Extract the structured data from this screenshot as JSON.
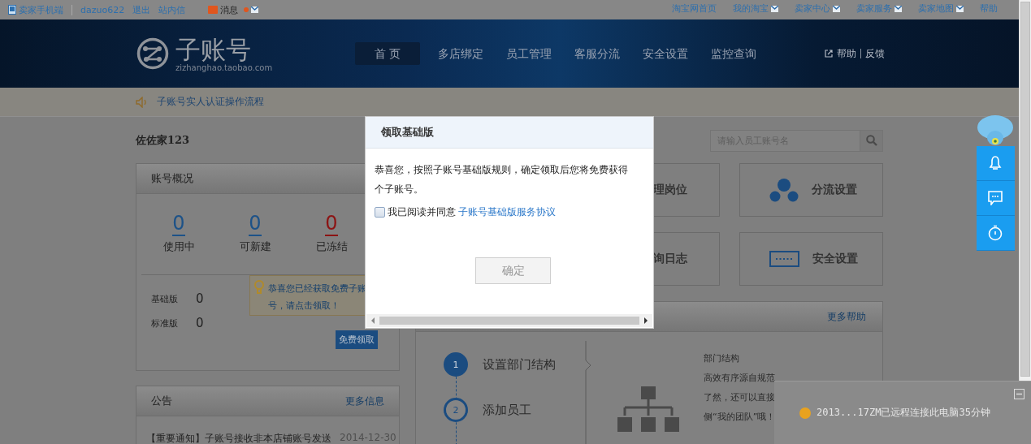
{
  "top_bar": {
    "left_links": [
      {
        "label": "卖家手机端",
        "kind": "phone"
      },
      {
        "label": "dazuo622",
        "kind": "plain"
      },
      {
        "label": "退出",
        "kind": "plain"
      },
      {
        "label": "站内信",
        "kind": "plain"
      }
    ],
    "message": {
      "label": "消息",
      "unread": true
    },
    "right_links": [
      {
        "label": "淘宝网首页",
        "dropdown": false
      },
      {
        "label": "我的淘宝",
        "dropdown": true
      },
      {
        "label": "卖家中心",
        "dropdown": true
      },
      {
        "label": "卖家服务",
        "dropdown": true
      },
      {
        "label": "卖家地图",
        "dropdown": true
      },
      {
        "label": "帮助",
        "dropdown": false
      }
    ]
  },
  "header": {
    "logo": {
      "title": "子账号",
      "subtitle": "zizhanghao.taobao.com"
    },
    "nav": [
      {
        "label": "首 页",
        "selected": true
      },
      {
        "label": "多店绑定",
        "selected": false
      },
      {
        "label": "员工管理",
        "selected": false
      },
      {
        "label": "客服分流",
        "selected": false
      },
      {
        "label": "安全设置",
        "selected": false
      },
      {
        "label": "监控查询",
        "selected": false
      }
    ],
    "help_links": [
      "帮助",
      "反馈"
    ]
  },
  "notice": {
    "text": "子账号实人认证操作流程"
  },
  "shop_name": "佐佐家123",
  "search": {
    "placeholder": "请输入员工账号名"
  },
  "account_panel": {
    "title": "账号概况",
    "stats": [
      {
        "value": "0",
        "label": "使用中",
        "color": "#1d5288"
      },
      {
        "value": "0",
        "label": "可新建",
        "color": "#1d5288"
      },
      {
        "value": "0",
        "label": "已冻结",
        "color": "#8c1414"
      }
    ],
    "versions": [
      {
        "label": "基础版",
        "count": "0"
      },
      {
        "label": "标准版",
        "count": "0"
      }
    ],
    "tip_lines": [
      "恭喜您已经获取免费子账",
      "号，请点击领取！"
    ],
    "button": "免费领取"
  },
  "announcements": {
    "title": "公告",
    "more": "更多信息",
    "items": [
      {
        "title": "【重要通知】子账号接收非本店铺账号发送",
        "date": "2014-12-30"
      }
    ]
  },
  "function_cards": [
    {
      "label": "理岗位",
      "kind": "covered"
    },
    {
      "label": "分流设置",
      "kind": "flow"
    },
    {
      "label": "询日志",
      "kind": "covered"
    },
    {
      "label": "安全设置",
      "kind": "password"
    }
  ],
  "help_panel": {
    "more": "更多帮助",
    "steps": [
      {
        "number": "1",
        "label": "设置部门结构",
        "selected": true
      },
      {
        "number": "2",
        "label": "添加员工",
        "selected": false
      }
    ],
    "detail": {
      "title": "部门结构",
      "lines": [
        "高效有序源自规范",
        "了然，还可以直接",
        "侧“我的团队”哦！"
      ]
    }
  },
  "dialog": {
    "title": "领取基础版",
    "message_lines": [
      "恭喜您，按照子账号基础版规则，确定领取后您将免费获得",
      "个子账号。"
    ],
    "agree": {
      "text": "我已阅读并同意",
      "link": "子账号基础版服务协议",
      "checked": false
    },
    "button": {
      "label": "确定",
      "disabled": true
    }
  },
  "toast": {
    "text": "2013...17ZM已远程连接此电脑35分钟"
  }
}
